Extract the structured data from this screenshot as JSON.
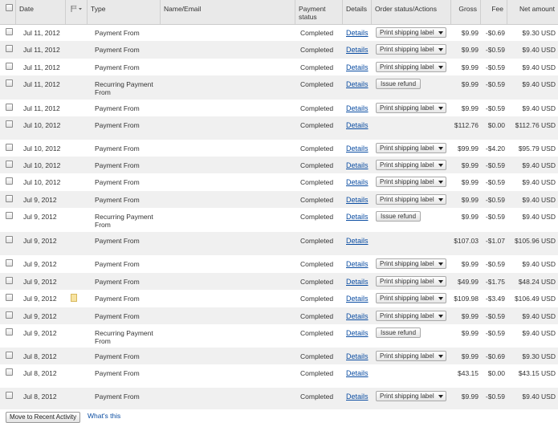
{
  "columns": {
    "date": "Date",
    "type": "Type",
    "name": "Name/Email",
    "status": "Payment status",
    "details": "Details",
    "order": "Order status/Actions",
    "gross": "Gross",
    "fee": "Fee",
    "net": "Net amount"
  },
  "rows": [
    {
      "date": "Jul 11, 2012",
      "type": "Payment From",
      "status": "Completed",
      "details": "Details",
      "action": "dropdown",
      "action_label": "Print shipping label",
      "gross": "$9.99",
      "fee": "-$0.69",
      "net": "$9.30 USD",
      "note": false
    },
    {
      "date": "Jul 11, 2012",
      "type": "Payment From",
      "status": "Completed",
      "details": "Details",
      "action": "dropdown",
      "action_label": "Print shipping label",
      "gross": "$9.99",
      "fee": "-$0.59",
      "net": "$9.40 USD",
      "note": false
    },
    {
      "date": "Jul 11, 2012",
      "type": "Payment From",
      "status": "Completed",
      "details": "Details",
      "action": "dropdown",
      "action_label": "Print shipping label",
      "gross": "$9.99",
      "fee": "-$0.59",
      "net": "$9.40 USD",
      "note": false
    },
    {
      "date": "Jul 11, 2012",
      "type": "Recurring Payment From",
      "status": "Completed",
      "details": "Details",
      "action": "button",
      "action_label": "Issue refund",
      "gross": "$9.99",
      "fee": "-$0.59",
      "net": "$9.40 USD",
      "note": false
    },
    {
      "date": "Jul 11, 2012",
      "type": "Payment From",
      "status": "Completed",
      "details": "Details",
      "action": "dropdown",
      "action_label": "Print shipping label",
      "gross": "$9.99",
      "fee": "-$0.59",
      "net": "$9.40 USD",
      "note": false
    },
    {
      "date": "Jul 10, 2012",
      "type": "Payment From",
      "status": "Completed",
      "details": "Details",
      "action": "none",
      "action_label": "",
      "gross": "$112.76",
      "fee": "$0.00",
      "net": "$112.76 USD",
      "note": false
    },
    {
      "date": "Jul 10, 2012",
      "type": "Payment From",
      "status": "Completed",
      "details": "Details",
      "action": "dropdown",
      "action_label": "Print shipping label",
      "gross": "$99.99",
      "fee": "-$4.20",
      "net": "$95.79 USD",
      "note": false
    },
    {
      "date": "Jul 10, 2012",
      "type": "Payment From",
      "status": "Completed",
      "details": "Details",
      "action": "dropdown",
      "action_label": "Print shipping label",
      "gross": "$9.99",
      "fee": "-$0.59",
      "net": "$9.40 USD",
      "note": false
    },
    {
      "date": "Jul 10, 2012",
      "type": "Payment From",
      "status": "Completed",
      "details": "Details",
      "action": "dropdown",
      "action_label": "Print shipping label",
      "gross": "$9.99",
      "fee": "-$0.59",
      "net": "$9.40 USD",
      "note": false
    },
    {
      "date": "Jul 9, 2012",
      "type": "Payment From",
      "status": "Completed",
      "details": "Details",
      "action": "dropdown",
      "action_label": "Print shipping label",
      "gross": "$9.99",
      "fee": "-$0.59",
      "net": "$9.40 USD",
      "note": false
    },
    {
      "date": "Jul 9, 2012",
      "type": "Recurring Payment From",
      "status": "Completed",
      "details": "Details",
      "action": "button",
      "action_label": "Issue refund",
      "gross": "$9.99",
      "fee": "-$0.59",
      "net": "$9.40 USD",
      "note": false
    },
    {
      "date": "Jul 9, 2012",
      "type": "Payment From",
      "status": "Completed",
      "details": "Details",
      "action": "none",
      "action_label": "",
      "gross": "$107.03",
      "fee": "-$1.07",
      "net": "$105.96 USD",
      "note": false
    },
    {
      "date": "Jul 9, 2012",
      "type": "Payment From",
      "status": "Completed",
      "details": "Details",
      "action": "dropdown",
      "action_label": "Print shipping label",
      "gross": "$9.99",
      "fee": "-$0.59",
      "net": "$9.40 USD",
      "note": false
    },
    {
      "date": "Jul 9, 2012",
      "type": "Payment From",
      "status": "Completed",
      "details": "Details",
      "action": "dropdown",
      "action_label": "Print shipping label",
      "gross": "$49.99",
      "fee": "-$1.75",
      "net": "$48.24 USD",
      "note": false
    },
    {
      "date": "Jul 9, 2012",
      "type": "Payment From",
      "status": "Completed",
      "details": "Details",
      "action": "dropdown",
      "action_label": "Print shipping label",
      "gross": "$109.98",
      "fee": "-$3.49",
      "net": "$106.49 USD",
      "note": true
    },
    {
      "date": "Jul 9, 2012",
      "type": "Payment From",
      "status": "Completed",
      "details": "Details",
      "action": "dropdown",
      "action_label": "Print shipping label",
      "gross": "$9.99",
      "fee": "-$0.59",
      "net": "$9.40 USD",
      "note": false
    },
    {
      "date": "Jul 9, 2012",
      "type": "Recurring Payment From",
      "status": "Completed",
      "details": "Details",
      "action": "button",
      "action_label": "Issue refund",
      "gross": "$9.99",
      "fee": "-$0.59",
      "net": "$9.40 USD",
      "note": false
    },
    {
      "date": "Jul 8, 2012",
      "type": "Payment From",
      "status": "Completed",
      "details": "Details",
      "action": "dropdown",
      "action_label": "Print shipping label",
      "gross": "$9.99",
      "fee": "-$0.69",
      "net": "$9.30 USD",
      "note": false
    },
    {
      "date": "Jul 8, 2012",
      "type": "Payment From",
      "status": "Completed",
      "details": "Details",
      "action": "none",
      "action_label": "",
      "gross": "$43.15",
      "fee": "$0.00",
      "net": "$43.15 USD",
      "note": false
    },
    {
      "date": "Jul 8, 2012",
      "type": "Payment From",
      "status": "Completed",
      "details": "Details",
      "action": "dropdown",
      "action_label": "Print shipping label",
      "gross": "$9.99",
      "fee": "-$0.59",
      "net": "$9.40 USD",
      "note": false
    }
  ],
  "footer": {
    "move_button": "Move to Recent Activity",
    "whats_this": "What's this"
  },
  "colors": {
    "link": "#0b4da2",
    "alt_row": "#f0f0f0",
    "header_bg": "#e9e9e9"
  },
  "icons": {
    "flag_filter": "flag-icon",
    "note": "note-icon"
  }
}
